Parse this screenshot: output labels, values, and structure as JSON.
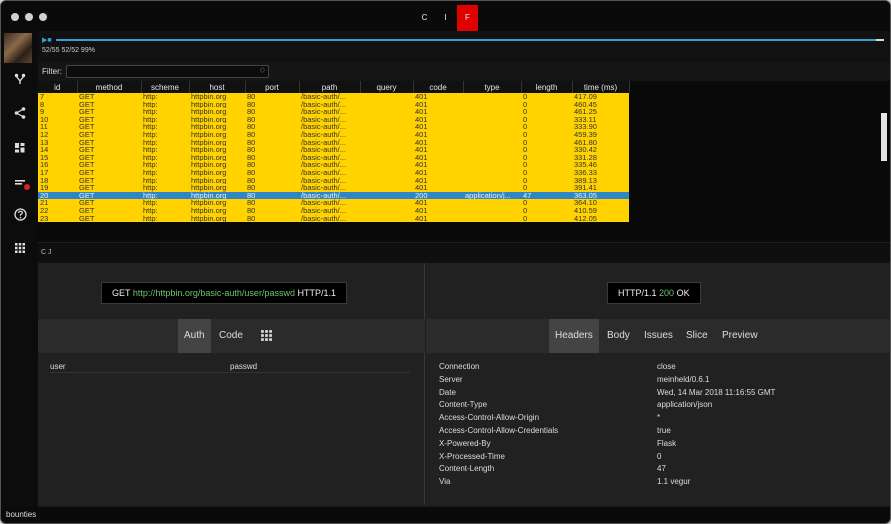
{
  "titlebar": {
    "modes": [
      "C",
      "I",
      "F"
    ],
    "active_mode_color": "#e00000"
  },
  "progress": {
    "stats": "52/55 52/52 99%",
    "fraction": 0.99
  },
  "filter": {
    "label": "Filter:",
    "value": ""
  },
  "table": {
    "columns": [
      "id",
      "method",
      "scheme",
      "host",
      "port",
      "path",
      "query",
      "code",
      "type",
      "length",
      "time (ms)"
    ],
    "rows": [
      [
        "7",
        "GET",
        "http:",
        "httpbin.org",
        "80",
        "/basic-auth/...",
        "",
        "401",
        "",
        "0",
        "417.09"
      ],
      [
        "8",
        "GET",
        "http:",
        "httpbin.org",
        "80",
        "/basic-auth/...",
        "",
        "401",
        "",
        "0",
        "460.45"
      ],
      [
        "9",
        "GET",
        "http:",
        "httpbin.org",
        "80",
        "/basic-auth/...",
        "",
        "401",
        "",
        "0",
        "461.25"
      ],
      [
        "10",
        "GET",
        "http:",
        "httpbin.org",
        "80",
        "/basic-auth/...",
        "",
        "401",
        "",
        "0",
        "333.11"
      ],
      [
        "11",
        "GET",
        "http:",
        "httpbin.org",
        "80",
        "/basic-auth/...",
        "",
        "401",
        "",
        "0",
        "333.90"
      ],
      [
        "12",
        "GET",
        "http:",
        "httpbin.org",
        "80",
        "/basic-auth/...",
        "",
        "401",
        "",
        "0",
        "459.39"
      ],
      [
        "13",
        "GET",
        "http:",
        "httpbin.org",
        "80",
        "/basic-auth/...",
        "",
        "401",
        "",
        "0",
        "461.80"
      ],
      [
        "14",
        "GET",
        "http:",
        "httpbin.org",
        "80",
        "/basic-auth/...",
        "",
        "401",
        "",
        "0",
        "330.42"
      ],
      [
        "15",
        "GET",
        "http:",
        "httpbin.org",
        "80",
        "/basic-auth/...",
        "",
        "401",
        "",
        "0",
        "331.28"
      ],
      [
        "16",
        "GET",
        "http:",
        "httpbin.org",
        "80",
        "/basic-auth/...",
        "",
        "401",
        "",
        "0",
        "335.46"
      ],
      [
        "17",
        "GET",
        "http:",
        "httpbin.org",
        "80",
        "/basic-auth/...",
        "",
        "401",
        "",
        "0",
        "336.33"
      ],
      [
        "18",
        "GET",
        "http:",
        "httpbin.org",
        "80",
        "/basic-auth/...",
        "",
        "401",
        "",
        "0",
        "389.13"
      ],
      [
        "19",
        "GET",
        "http:",
        "httpbin.org",
        "80",
        "/basic-auth/...",
        "",
        "401",
        "",
        "0",
        "391.41"
      ],
      [
        "20",
        "GET",
        "http:",
        "httpbin.org",
        "80",
        "/basic-auth/...",
        "",
        "200",
        "application/j...",
        "47",
        "363.05"
      ],
      [
        "21",
        "GET",
        "http:",
        "httpbin.org",
        "80",
        "/basic-auth/...",
        "",
        "401",
        "",
        "0",
        "364.10"
      ],
      [
        "22",
        "GET",
        "http:",
        "httpbin.org",
        "80",
        "/basic-auth/...",
        "",
        "401",
        "",
        "0",
        "410.59"
      ],
      [
        "23",
        "GET",
        "http:",
        "httpbin.org",
        "80",
        "/basic-auth/...",
        "",
        "401",
        "",
        "0",
        "412.05"
      ]
    ],
    "selected_id": "20",
    "row_color": "#ffd200",
    "selected_color": "#2f86c6"
  },
  "request_bar": {
    "text": "C J"
  },
  "request": {
    "method": "GET",
    "url": "http://httpbin.org/basic-auth/user/passwd",
    "version": "HTTP/1.1",
    "tabs": [
      "Auth",
      "Code"
    ],
    "active_tab": "Auth",
    "auth": {
      "user": "user",
      "password": "passwd"
    }
  },
  "response": {
    "version": "HTTP/1.1",
    "status_code": "200",
    "status_text": "OK",
    "tabs": [
      "Headers",
      "Body",
      "Issues",
      "Slice",
      "Preview"
    ],
    "active_tab": "Headers",
    "headers": [
      [
        "Connection",
        "close"
      ],
      [
        "Server",
        "meinheld/0.6.1"
      ],
      [
        "Date",
        "Wed, 14 Mar 2018 11:16:55 GMT"
      ],
      [
        "Content-Type",
        "application/json"
      ],
      [
        "Access-Control-Allow-Origin",
        "*"
      ],
      [
        "Access-Control-Allow-Credentials",
        "true"
      ],
      [
        "X-Powered-By",
        "Flask"
      ],
      [
        "X-Processed-Time",
        "0"
      ],
      [
        "Content-Length",
        "47"
      ],
      [
        "Via",
        "1.1 vegur"
      ]
    ]
  },
  "statusbar": {
    "text": "bounties"
  }
}
